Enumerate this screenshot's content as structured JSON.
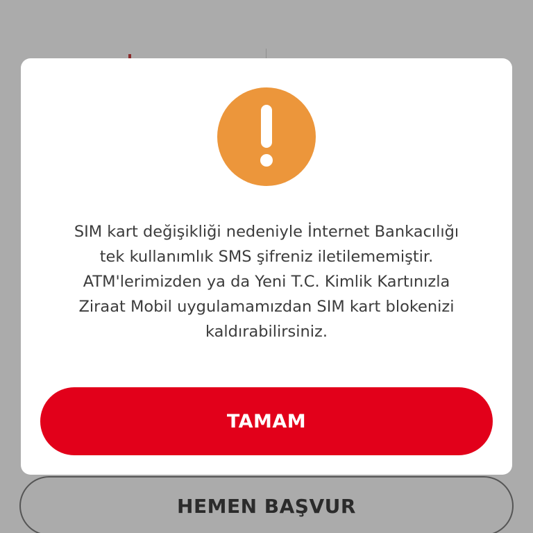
{
  "background": {
    "apply_button_label": "HEMEN BAŞVUR"
  },
  "dialog": {
    "icon": "exclamation-icon",
    "message": "SIM kart değişikliği nedeniyle İnternet Bankacılığı tek kullanımlık SMS şifreniz iletilememiştir. ATM'lerimizden ya da Yeni T.C. Kimlik Kartınızla Ziraat Mobil uygulamamızdan SIM kart blokenizi kaldırabilirsiniz.",
    "ok_button_label": "TAMAM"
  },
  "colors": {
    "overlay": "#ababab",
    "icon_orange": "#ec963b",
    "primary_red": "#e2001a",
    "dialog_bg": "#ffffff",
    "text": "#3c3c3c"
  }
}
